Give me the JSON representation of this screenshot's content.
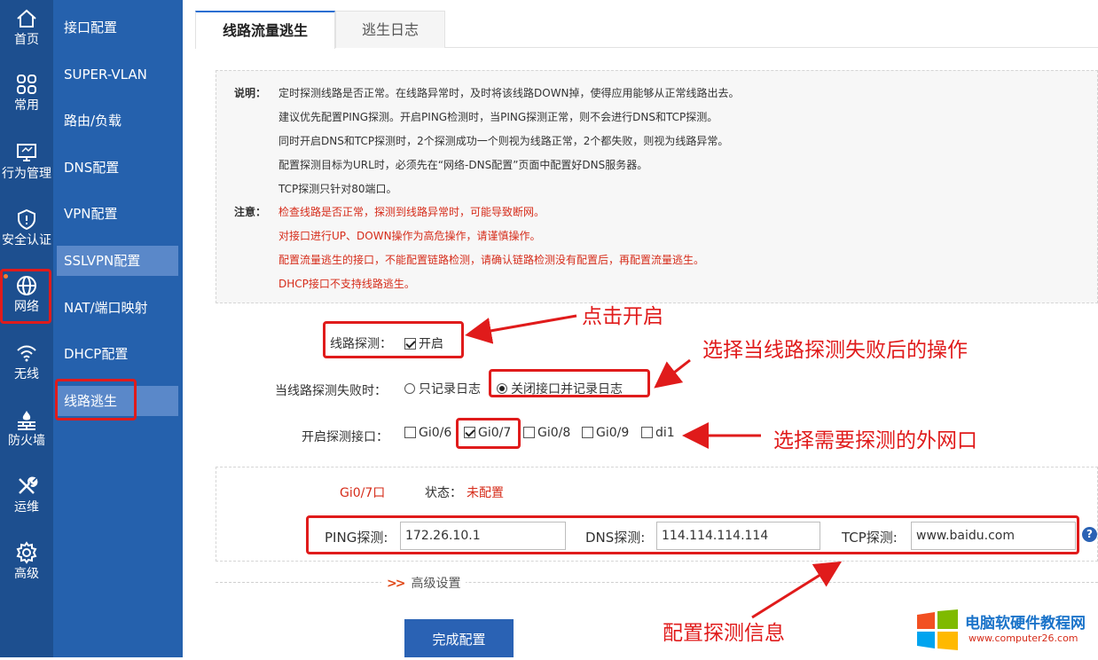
{
  "rail": [
    {
      "label": "首页",
      "icon": "home-icon"
    },
    {
      "label": "常用",
      "icon": "grid-icon"
    },
    {
      "label": "行为管理",
      "icon": "monitor-icon"
    },
    {
      "label": "安全认证",
      "icon": "shield-icon"
    },
    {
      "label": "网络",
      "icon": "globe-icon"
    },
    {
      "label": "无线",
      "icon": "wifi-icon"
    },
    {
      "label": "防火墙",
      "icon": "firewall-icon"
    },
    {
      "label": "运维",
      "icon": "tools-icon"
    },
    {
      "label": "高级",
      "icon": "gear-icon"
    }
  ],
  "sidebar": [
    {
      "label": "接口配置"
    },
    {
      "label": "SUPER-VLAN"
    },
    {
      "label": "路由/负载"
    },
    {
      "label": "DNS配置"
    },
    {
      "label": "VPN配置"
    },
    {
      "label": "SSLVPN配置"
    },
    {
      "label": "NAT/端口映射"
    },
    {
      "label": "DHCP配置"
    },
    {
      "label": "线路逃生"
    }
  ],
  "tabs": [
    {
      "label": "线路流量逃生"
    },
    {
      "label": "逃生日志"
    }
  ],
  "info": {
    "desc_key": "说明：",
    "desc": [
      "定时探测线路是否正常。在线路异常时，及时将该线路DOWN掉，使得应用能够从正常线路出去。",
      "建议优先配置PING探测。开启PING检测时，当PING探测正常，则不会进行DNS和TCP探测。",
      "同时开启DNS和TCP探测时，2个探测成功一个则视为线路正常，2个都失败，则视为线路异常。",
      "配置探测目标为URL时，必须先在“网络-DNS配置”页面中配置好DNS服务器。",
      "TCP探测只针对80端口。"
    ],
    "note_key": "注意：",
    "notes": [
      "检查线路是否正常，探测到线路异常时，可能导致断网。",
      "对接口进行UP、DOWN操作为高危操作，请谨慎操作。",
      "配置流量逃生的接口，不能配置链路检测，请确认链路检测没有配置后，再配置流量逃生。",
      "DHCP接口不支持线路逃生。"
    ]
  },
  "form": {
    "probe_label": "线路探测：",
    "probe_option": "开启",
    "probe_checked": true,
    "fail_label": "当线路探测失败时：",
    "fail_options": [
      "只记录日志",
      "关闭接口并记录日志"
    ],
    "fail_selected": 1,
    "iface_label": "开启探测接口：",
    "ifaces": [
      {
        "name": "Gi0/6",
        "checked": false
      },
      {
        "name": "Gi0/7",
        "checked": true
      },
      {
        "name": "Gi0/8",
        "checked": false
      },
      {
        "name": "Gi0/9",
        "checked": false
      },
      {
        "name": "di1",
        "checked": false
      }
    ]
  },
  "iface_panel": {
    "name": "Gi0/7口",
    "status_label": "状态：",
    "status_value": "未配置",
    "ping_label": "PING探测:",
    "ping_value": "172.26.10.1",
    "dns_label": "DNS探测:",
    "dns_value": "114.114.114.114",
    "tcp_label": "TCP探测:",
    "tcp_value": "www.baidu.com"
  },
  "advanced": {
    "label": "高级设置"
  },
  "done_button": "完成配置",
  "annotations": {
    "a1": "点击开启",
    "a2": "选择当线路探测失败后的操作",
    "a3": "选择需要探测的外网口",
    "a4": "配置探测信息"
  },
  "watermark": {
    "title": "电脑软硬件教程网",
    "url": "www.computer26.com"
  },
  "colors": {
    "rail": "#1d4f8f",
    "sidebar": "#2561ad",
    "accent": "#2a62b4",
    "annotation": "#e01b1b",
    "warning": "#d62c1a"
  }
}
